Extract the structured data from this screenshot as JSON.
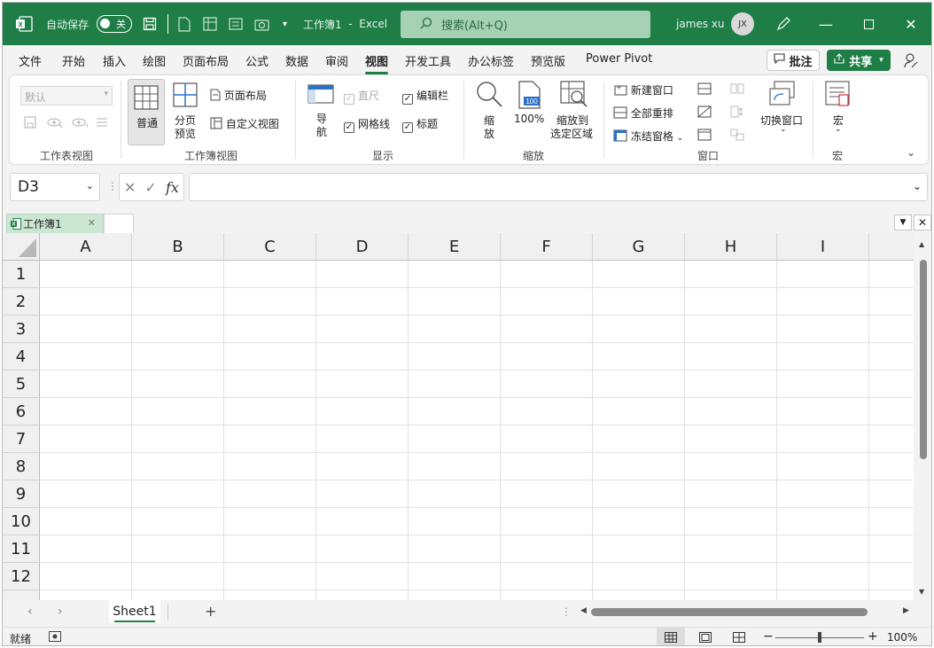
{
  "titlebar": {
    "autosave_label": "自动保存",
    "autosave_state": "关",
    "doc_title": "工作簿1",
    "separator": "-",
    "app_name": "Excel",
    "search_placeholder": "搜索(Alt+Q)",
    "user_name": "james xu",
    "user_initials": "JX"
  },
  "menu": {
    "tabs": [
      "文件",
      "开始",
      "插入",
      "绘图",
      "页面布局",
      "公式",
      "数据",
      "审阅",
      "视图",
      "开发工具",
      "办公标签",
      "预览版",
      "Power Pivot"
    ],
    "active_tab": "视图",
    "comment_label": "批注",
    "share_label": "共享"
  },
  "ribbon": {
    "sheet_view": {
      "default_select": "默认",
      "group_label": "工作表视图"
    },
    "workbook_view": {
      "normal": "普通",
      "page_break_1": "分页",
      "page_break_2": "预览",
      "page_layout": "页面布局",
      "custom_view": "自定义视图",
      "group_label": "工作簿视图"
    },
    "show": {
      "navigation_1": "导",
      "navigation_2": "航",
      "ruler": "直尺",
      "gridlines": "网格线",
      "formula_bar": "编辑栏",
      "headings": "标题",
      "group_label": "显示"
    },
    "zoom": {
      "zoom_1": "缩",
      "zoom_2": "放",
      "hundred": "100%",
      "hundred_icon": "100",
      "to_selection_1": "缩放到",
      "to_selection_2": "选定区域",
      "group_label": "缩放"
    },
    "window": {
      "new_window": "新建窗口",
      "arrange_all": "全部重排",
      "freeze_panes": "冻结窗格",
      "switch_windows": "切换窗口",
      "group_label": "窗口"
    },
    "macros": {
      "macros": "宏",
      "group_label": "宏"
    }
  },
  "formula_bar": {
    "name_box": "D3",
    "fx": "fx"
  },
  "workbook_tab": {
    "label": "工作簿1"
  },
  "grid": {
    "columns": [
      "A",
      "B",
      "C",
      "D",
      "E",
      "F",
      "G",
      "H",
      "I"
    ],
    "rows": [
      "1",
      "2",
      "3",
      "4",
      "5",
      "6",
      "7",
      "8",
      "9",
      "10",
      "11",
      "12"
    ]
  },
  "sheets": {
    "active": "Sheet1",
    "add": "+"
  },
  "status": {
    "ready": "就绪",
    "zoom": "100%"
  },
  "colors": {
    "accent": "#1e7e45",
    "search_bg": "#a7d1b4"
  }
}
